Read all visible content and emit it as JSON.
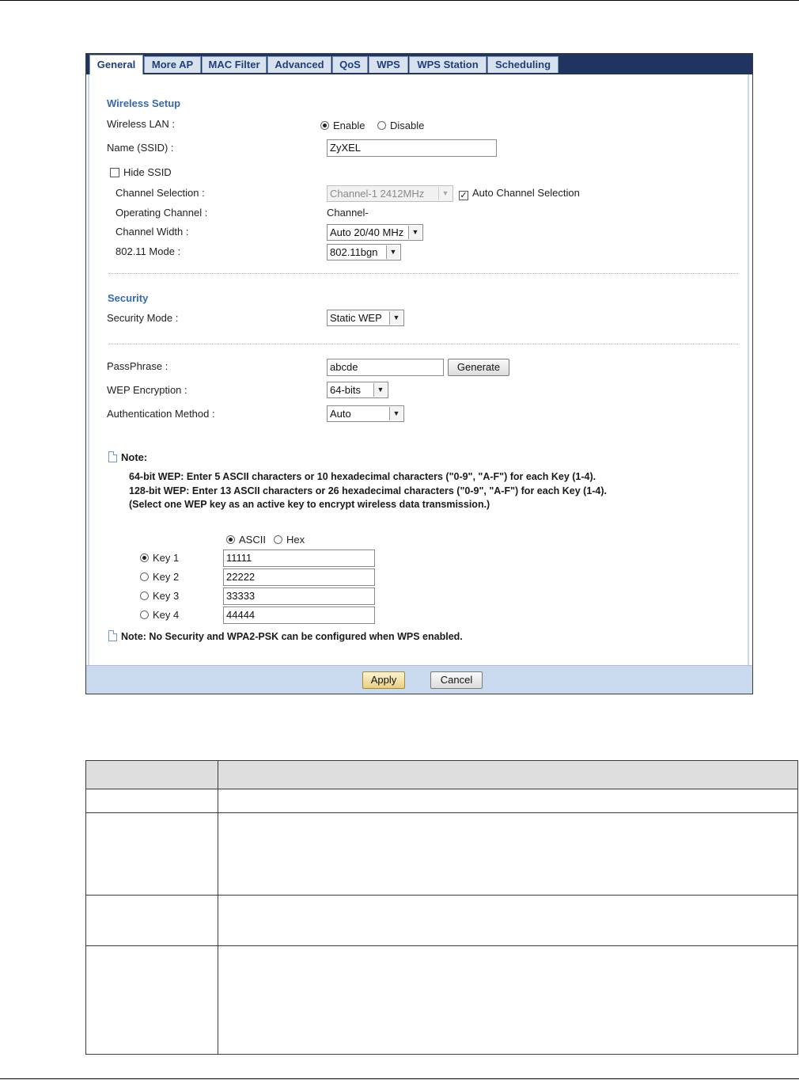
{
  "tabs": [
    "General",
    "More AP",
    "MAC Filter",
    "Advanced",
    "QoS",
    "WPS",
    "WPS Station",
    "Scheduling"
  ],
  "wireless_setup": {
    "heading": "Wireless Setup",
    "wireless_lan_label": "Wireless LAN :",
    "enable_label": "Enable",
    "disable_label": "Disable",
    "enabled": true,
    "ssid_label": "Name (SSID) :",
    "ssid_value": "ZyXEL",
    "hide_ssid_label": "Hide SSID",
    "hide_ssid_checked": false,
    "channel_selection_label": "Channel Selection :",
    "channel_selection_value": "Channel-1 2412MHz",
    "auto_channel_label": "Auto Channel Selection",
    "auto_channel_checked": true,
    "operating_channel_label": "Operating Channel :",
    "operating_channel_value": "Channel-",
    "channel_width_label": "Channel Width :",
    "channel_width_value": "Auto 20/40 MHz",
    "mode_label": "802.11 Mode :",
    "mode_value": "802.11bgn"
  },
  "security": {
    "heading": "Security",
    "mode_label": "Security Mode :",
    "mode_value": "Static WEP",
    "passphrase_label": "PassPhrase :",
    "passphrase_value": "abcde",
    "generate_label": "Generate",
    "wep_encryption_label": "WEP Encryption :",
    "wep_encryption_value": "64-bits",
    "auth_method_label": "Authentication Method :",
    "auth_method_value": "Auto"
  },
  "note": {
    "title": "Note:",
    "line1": "64-bit WEP: Enter 5 ASCII characters or 10 hexadecimal characters (\"0-9\", \"A-F\") for each Key (1-4).",
    "line2": "128-bit WEP: Enter 13 ASCII characters or 26 hexadecimal characters (\"0-9\", \"A-F\") for each Key (1-4).",
    "line3": "(Select one WEP key as an active key to encrypt wireless data transmission.)",
    "wps_note": "Note: No Security and WPA2-PSK can be configured when WPS enabled."
  },
  "keys": {
    "ascii_label": "ASCII",
    "hex_label": "Hex",
    "format": "ASCII",
    "active_key": 1,
    "items": [
      {
        "label": "Key 1",
        "value": "11111"
      },
      {
        "label": "Key 2",
        "value": "22222"
      },
      {
        "label": "Key 3",
        "value": "33333"
      },
      {
        "label": "Key 4",
        "value": "44444"
      }
    ]
  },
  "buttons": {
    "apply": "Apply",
    "cancel": "Cancel"
  }
}
